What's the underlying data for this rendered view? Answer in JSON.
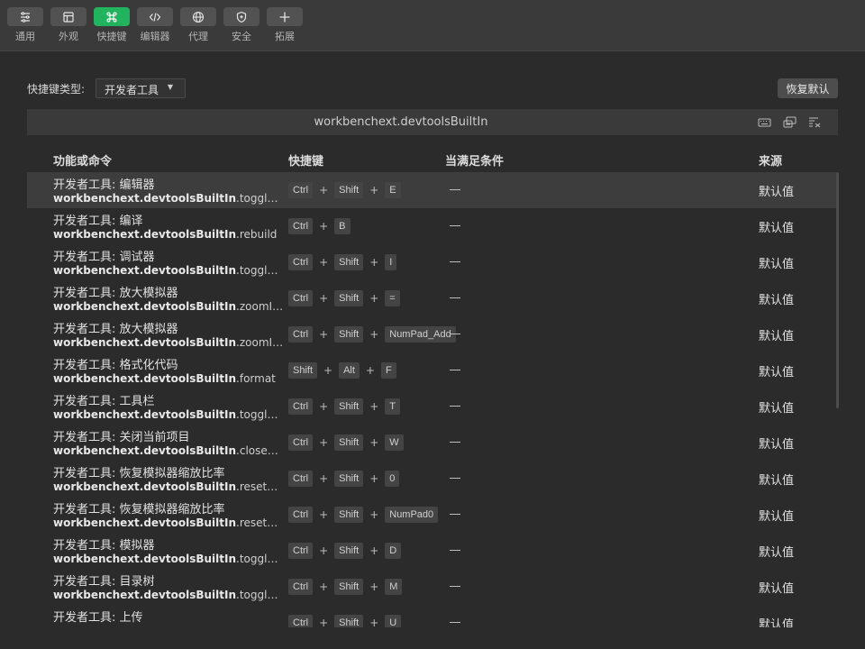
{
  "toolbar": {
    "items": [
      {
        "label": "通用",
        "icon": "sliders-icon",
        "active": false
      },
      {
        "label": "外观",
        "icon": "layout-icon",
        "active": false
      },
      {
        "label": "快捷键",
        "icon": "command-key-icon",
        "active": true
      },
      {
        "label": "编辑器",
        "icon": "code-icon",
        "active": false
      },
      {
        "label": "代理",
        "icon": "globe-icon",
        "active": false
      },
      {
        "label": "安全",
        "icon": "shield-icon",
        "active": false
      },
      {
        "label": "拓展",
        "icon": "plus-icon",
        "active": false
      }
    ]
  },
  "shortcut_type": {
    "label": "快捷键类型:",
    "selected": "开发者工具"
  },
  "restore_default_label": "恢复默认",
  "extension_bar": {
    "title": "workbenchext.devtoolsBuiltIn",
    "actions": [
      "keyboard-icon",
      "record-keys-icon",
      "clear-filter-icon"
    ]
  },
  "table": {
    "headers": {
      "command": "功能或命令",
      "keybinding": "快捷键",
      "when": "当满足条件",
      "source": "来源"
    },
    "rows": [
      {
        "title": "开发者工具: 编辑器",
        "prefix": "workbenchext.devtoolsBuiltIn",
        "suffix": ".toggleEditorWi...",
        "keys": [
          "Ctrl",
          "Shift",
          "E"
        ],
        "when": "—",
        "source": "默认值",
        "selected": true
      },
      {
        "title": "开发者工具: 编译",
        "prefix": "workbenchext.devtoolsBuiltIn",
        "suffix": ".rebuild",
        "keys": [
          "Ctrl",
          "B"
        ],
        "when": "—",
        "source": "默认值"
      },
      {
        "title": "开发者工具: 调试器",
        "prefix": "workbenchext.devtoolsBuiltIn",
        "suffix": ".toggleDebug...",
        "keys": [
          "Ctrl",
          "Shift",
          "I"
        ],
        "when": "—",
        "source": "默认值"
      },
      {
        "title": "开发者工具: 放大模拟器",
        "prefix": "workbenchext.devtoolsBuiltIn",
        "suffix": ".zoomInSimulat...",
        "keys": [
          "Ctrl",
          "Shift",
          "="
        ],
        "when": "—",
        "source": "默认值"
      },
      {
        "title": "开发者工具: 放大模拟器",
        "prefix": "workbenchext.devtoolsBuiltIn",
        "suffix": ".zoomInSimulat...",
        "keys": [
          "Ctrl",
          "Shift",
          "NumPad_Add"
        ],
        "when": "—",
        "source": "默认值"
      },
      {
        "title": "开发者工具: 格式化代码",
        "prefix": "workbenchext.devtoolsBuiltIn",
        "suffix": ".format",
        "keys": [
          "Shift",
          "Alt",
          "F"
        ],
        "when": "—",
        "source": "默认值"
      },
      {
        "title": "开发者工具: 工具栏",
        "prefix": "workbenchext.devtoolsBuiltIn",
        "suffix": ".toggleToolbar",
        "keys": [
          "Ctrl",
          "Shift",
          "T"
        ],
        "when": "—",
        "source": "默认值"
      },
      {
        "title": "开发者工具: 关闭当前项目",
        "prefix": "workbenchext.devtoolsBuiltIn",
        "suffix": ".closeProject",
        "keys": [
          "Ctrl",
          "Shift",
          "W"
        ],
        "when": "—",
        "source": "默认值"
      },
      {
        "title": "开发者工具: 恢复模拟器缩放比率",
        "prefix": "workbenchext.devtoolsBuiltIn",
        "suffix": ".resetZoomSim...",
        "keys": [
          "Ctrl",
          "Shift",
          "0"
        ],
        "when": "—",
        "source": "默认值"
      },
      {
        "title": "开发者工具: 恢复模拟器缩放比率",
        "prefix": "workbenchext.devtoolsBuiltIn",
        "suffix": ".resetZoomSim...",
        "keys": [
          "Ctrl",
          "Shift",
          "NumPad0"
        ],
        "when": "—",
        "source": "默认值"
      },
      {
        "title": "开发者工具: 模拟器",
        "prefix": "workbenchext.devtoolsBuiltIn",
        "suffix": ".toggleSimulat...",
        "keys": [
          "Ctrl",
          "Shift",
          "D"
        ],
        "when": "—",
        "source": "默认值"
      },
      {
        "title": "开发者工具: 目录树",
        "prefix": "workbenchext.devtoolsBuiltIn",
        "suffix": ".toggleFileTree",
        "keys": [
          "Ctrl",
          "Shift",
          "M"
        ],
        "when": "—",
        "source": "默认值"
      },
      {
        "title": "开发者工具: 上传",
        "prefix": "",
        "suffix": "",
        "keys": [
          "Ctrl",
          "Shift",
          "U"
        ],
        "when": "—",
        "source": "默认值"
      }
    ]
  }
}
